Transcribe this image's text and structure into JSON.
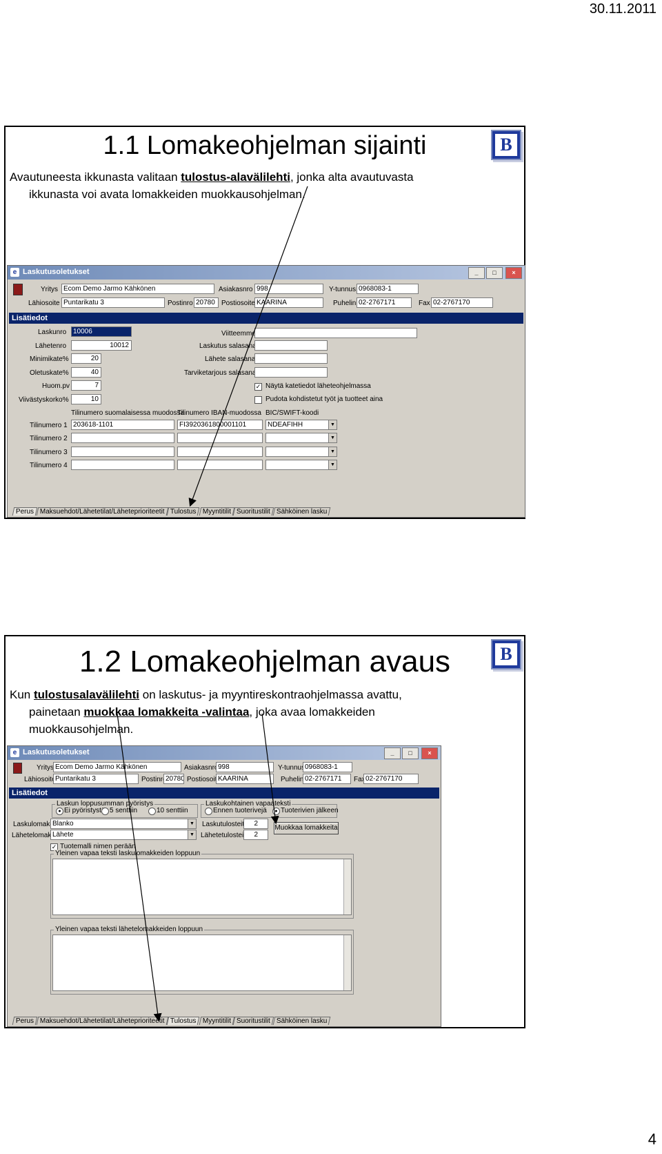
{
  "page": {
    "date": "30.11.2011",
    "number": "4"
  },
  "slide1": {
    "title": "1.1 Lomakeohjelman sijainti",
    "text_pre": "Avautuneesta ikkunasta valitaan ",
    "text_link": "tulostus-alavälilehti",
    "text_post": ", jonka alta avautuvasta",
    "text_line2": "ikkunasta voi avata lomakkeiden muokkausohjelman.",
    "logo": "B",
    "window": {
      "title": "Laskutusoletukset",
      "controls": [
        "_",
        "□",
        "×"
      ],
      "header": {
        "yritys_label": "Yritys",
        "yritys_value": "Ecom Demo Jarmo Kähkönen",
        "asiakasnro_label": "Asiakasnro",
        "asiakasnro_value": "998",
        "ytunnus_label": "Y-tunnus",
        "ytunnus_value": "0968083-1",
        "lahiosoite_label": "Lähiosoite",
        "lahiosoite_value": "Puntarikatu 3",
        "postinro_label": "Postinro",
        "postinro_value": "20780",
        "postiosoite_label": "Postiosoite",
        "postiosoite_value": "KAARINA",
        "puhelin_label": "Puhelin",
        "puhelin_value": "02-2767171",
        "fax_label": "Fax",
        "fax_value": "02-2767170"
      },
      "section": "Lisätiedot",
      "left_fields": [
        {
          "label": "Laskunro",
          "value": "10006"
        },
        {
          "label": "Lähetenro",
          "value": "10012"
        },
        {
          "label": "Minimikate%",
          "value": "20"
        },
        {
          "label": "Oletuskate%",
          "value": "40"
        },
        {
          "label": "Huom.pv",
          "value": "7"
        },
        {
          "label": "Viivästyskorko%",
          "value": "10"
        }
      ],
      "right_fields": [
        "Viitteemme",
        "Laskutus salasana",
        "Lähete salasana",
        "Tarviketarjous salasana"
      ],
      "checkboxes": [
        {
          "label": "Näytä katetiedot läheteohjelmassa",
          "checked": true
        },
        {
          "label": "Pudota kohdistetut työt ja tuotteet aina",
          "checked": false
        }
      ],
      "account_headers": [
        "Tilinumero suomalaisessa muodossa",
        "Tilinumero IBAN-muodossa",
        "BIC/SWIFT-koodi"
      ],
      "accounts": [
        {
          "label": "Tilinumero 1",
          "fi": "203618-1101",
          "iban": "FI3920361800001101",
          "bic": "NDEAFIHH"
        },
        {
          "label": "Tilinumero 2",
          "fi": "",
          "iban": "",
          "bic": ""
        },
        {
          "label": "Tilinumero 3",
          "fi": "",
          "iban": "",
          "bic": ""
        },
        {
          "label": "Tilinumero 4",
          "fi": "",
          "iban": "",
          "bic": ""
        }
      ],
      "tabs": [
        "Perus",
        "Maksuehdot/Lähetetilat/Läheteprioriteetit",
        "Tulostus",
        "Myyntitilit",
        "Suoritustilit",
        "Sähköinen lasku"
      ]
    }
  },
  "slide2": {
    "title": "1.2 Lomakeohjelman avaus",
    "text_pre": "Kun ",
    "text_link1": "tulostusalavälilehti",
    "text_mid": " on laskutus- ja myyntireskontraohjelmassa avattu,",
    "text_line2_pre": "painetaan ",
    "text_link2": "muokkaa lomakkeita -valintaa",
    "text_line2_post": ", joka avaa lomakkeiden",
    "text_line3": "muokkausohjelman.",
    "logo": "B",
    "window": {
      "title": "Laskutusoletukset",
      "controls": [
        "_",
        "□",
        "×"
      ],
      "header": {
        "yritys_label": "Yritys",
        "yritys_value": "Ecom Demo Jarmo Kähkönen",
        "asiakasnro_label": "Asiakasnro",
        "asiakasnro_value": "998",
        "ytunnus_label": "Y-tunnus",
        "ytunnus_value": "0968083-1",
        "lahiosoite_label": "Lähiosoite",
        "lahiosoite_value": "Puntarikatu 3",
        "postinro_label": "Postinro",
        "postinro_value": "20780",
        "postiosoite_label": "Postiosoite",
        "postiosoite_value": "KAARINA",
        "puhelin_label": "Puhelin",
        "puhelin_value": "02-2767171",
        "fax_label": "Fax",
        "fax_value": "02-2767170"
      },
      "section": "Lisätiedot",
      "rounding_group": "Laskun loppusumman pyöristys",
      "rounding_options": [
        "Ei pyöristystä",
        "5 senttiin",
        "10 senttiin"
      ],
      "row_group": "Laskukohtainen vapaateksti",
      "row_options": [
        "Ennen tuoterivejä",
        "Tuoterivien jälkeen"
      ],
      "laskulomake_label": "Laskulomake",
      "laskulomake_value": "Blanko",
      "lahetelomake_label": "Lähetelomake",
      "lahetelomake_value": "Lähete",
      "laskutulosteita_label": "Laskutulosteita",
      "laskutulosteita_value": "2",
      "lahetetulosteita_label": "Lähetetulosteita",
      "lahetetulosteita_value": "2",
      "muokkaa_button": "Muokkaa lomakkeita",
      "tuotemalli_label": "Tuotemalli nimen perään",
      "textarea1_label": "Yleinen vapaa teksti laskulomakkeiden loppuun",
      "textarea2_label": "Yleinen vapaa teksti lähetelomakkeiden loppuun",
      "tabs": [
        "Perus",
        "Maksuehdot/Lähetetilat/Läheteprioriteetit",
        "Tulostus",
        "Myyntitilit",
        "Suoritustilit",
        "Sähköinen lasku"
      ]
    }
  }
}
